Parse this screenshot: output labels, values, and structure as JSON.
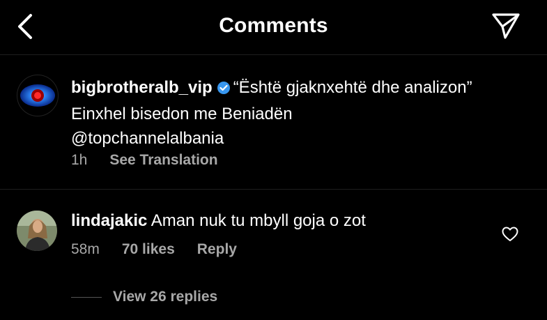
{
  "header": {
    "title": "Comments"
  },
  "post": {
    "username": "bigbrotheralb_vip",
    "caption_line1": "“Është gjaknxehtë dhe analizon”",
    "caption_line2": "Einxhel bisedon me Beniadën",
    "mention": "@topchannelalbania",
    "time": "1h",
    "translate_label": "See Translation"
  },
  "comment": {
    "username": "lindajakic",
    "text": "Aman nuk tu mbyll goja o zot",
    "time": "58m",
    "likes": "70 likes",
    "reply_label": "Reply",
    "view_replies": "View 26 replies"
  },
  "colors": {
    "background": "#000000",
    "text": "#ffffff",
    "muted": "#a8a8a8",
    "verified": "#3897f0"
  }
}
